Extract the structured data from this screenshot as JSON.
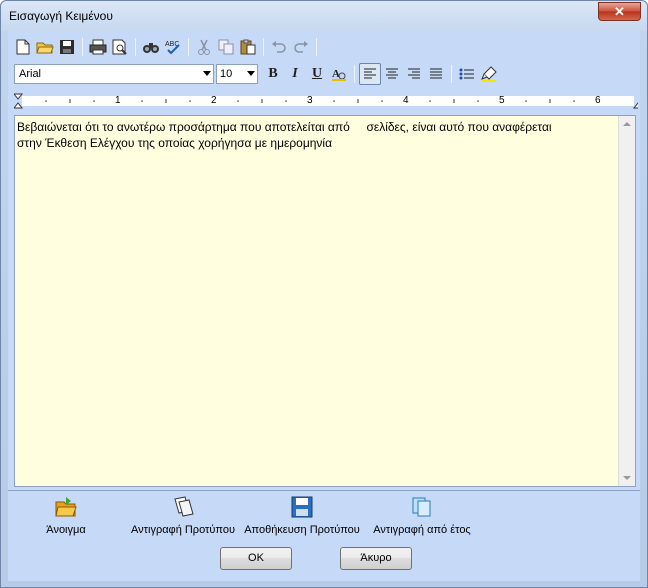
{
  "window": {
    "title": "Εισαγωγή Κειμένου",
    "close_glyph": "✕"
  },
  "toolbar_top": {
    "icons": [
      "new-document-icon",
      "open-folder-icon",
      "save-icon",
      "print-icon",
      "print-preview-icon",
      "find-icon",
      "spellcheck-icon",
      "cut-icon",
      "copy-icon",
      "paste-icon",
      "undo-icon",
      "redo-icon"
    ]
  },
  "format_bar": {
    "font": "Arial",
    "size": "10",
    "bold": "B",
    "italic": "I",
    "underline": "U"
  },
  "ruler": {
    "marks": [
      "1",
      "2",
      "3",
      "4",
      "5",
      "6"
    ]
  },
  "editor": {
    "text": "Βεβαιώνεται ότι το ανωτέρω προσάρτημα που αποτελείται από     σελίδες, είναι αυτό που αναφέρεται\nστην Έκθεση Ελέγχου της οποίας χορήγησα με ημερομηνία"
  },
  "actions": [
    {
      "label": "Άνοιγμα",
      "icon": "open-folder-icon"
    },
    {
      "label": "Αντιγραφή Προτύπου",
      "icon": "copy-template-icon"
    },
    {
      "label": "Αποθήκευση Προτύπου",
      "icon": "save-template-icon"
    },
    {
      "label": "Αντιγραφή από έτος",
      "icon": "copy-from-year-icon"
    }
  ],
  "buttons": {
    "ok": "OK",
    "cancel": "Άκυρο"
  },
  "colors": {
    "editor_bg": "#ffffe0",
    "client_bg": "#c6d9f6",
    "close_red": "#c9503a"
  }
}
